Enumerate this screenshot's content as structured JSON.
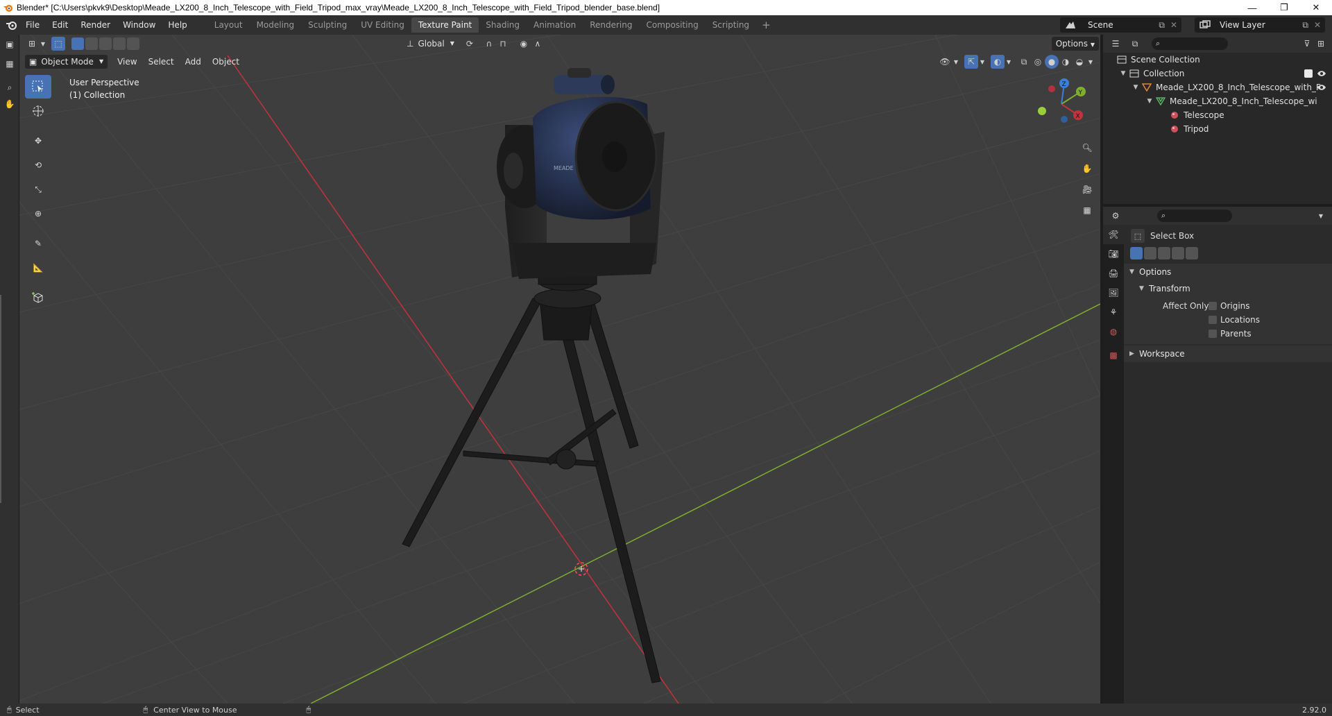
{
  "window": {
    "title": "Blender* [C:\\Users\\pkvk9\\Desktop\\Meade_LX200_8_Inch_Telescope_with_Field_Tripod_max_vray\\Meade_LX200_8_Inch_Telescope_with_Field_Tripod_blender_base.blend]",
    "minimize": "—",
    "maximize": "❐",
    "close": "✕"
  },
  "menu": [
    "File",
    "Edit",
    "Render",
    "Window",
    "Help"
  ],
  "workspaces": [
    {
      "label": "Layout",
      "active": false
    },
    {
      "label": "Modeling",
      "active": false
    },
    {
      "label": "Sculpting",
      "active": false
    },
    {
      "label": "UV Editing",
      "active": false
    },
    {
      "label": "Texture Paint",
      "active": true
    },
    {
      "label": "Shading",
      "active": false
    },
    {
      "label": "Animation",
      "active": false
    },
    {
      "label": "Rendering",
      "active": false
    },
    {
      "label": "Compositing",
      "active": false
    },
    {
      "label": "Scripting",
      "active": false
    }
  ],
  "workspace_add": "+",
  "scene": {
    "label": "Scene"
  },
  "view_layer": {
    "label": "View Layer"
  },
  "viewport": {
    "orientation": "Global",
    "options": "Options",
    "mode": "Object Mode",
    "header_menus": [
      "View",
      "Select",
      "Add",
      "Object"
    ],
    "overlay_line1": "User Perspective",
    "overlay_line2": "(1) Collection",
    "gizmo_x": "X",
    "gizmo_y": "Y",
    "gizmo_z": "Z",
    "colors": {
      "x_axis": "#c4323d",
      "y_axis": "#7fae2f",
      "bg": "#3e3e3e",
      "grid": "#4a4a4a"
    }
  },
  "outliner": {
    "scene_collection": "Scene Collection",
    "collection": "Collection",
    "object": "Meade_LX200_8_Inch_Telescope_with_F",
    "mesh": "Meade_LX200_8_Inch_Telescope_wi",
    "materials": [
      "Telescope",
      "Tripod"
    ]
  },
  "properties": {
    "tool_name": "Select Box",
    "options_panel": "Options",
    "transform_panel": "Transform",
    "affect_only": "Affect Only",
    "checks": [
      "Origins",
      "Locations",
      "Parents"
    ],
    "workspace_panel": "Workspace"
  },
  "status": {
    "select": "Select",
    "center_view": "Center View to Mouse",
    "version": "2.92.0"
  },
  "accent": "#4772b3"
}
